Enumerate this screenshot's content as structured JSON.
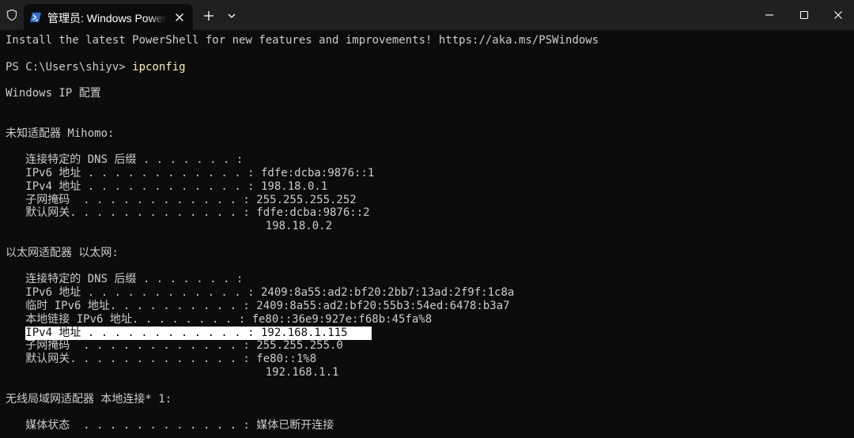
{
  "window": {
    "tab_title": "管理员: Windows PowerShell"
  },
  "terminal": {
    "lines": [
      "Install the latest PowerShell for new features and improvements! https://aka.ms/PSWindows",
      "",
      "PS C:\\Users\\shiyv> ",
      "",
      "Windows IP 配置",
      "",
      "",
      "未知适配器 Mihomo:",
      "",
      "   连接特定的 DNS 后缀 . . . . . . . :",
      "   IPv6 地址 . . . . . . . . . . . . : fdfe:dcba:9876::1",
      "   IPv4 地址 . . . . . . . . . . . . : 198.18.0.1",
      "   子网掩码  . . . . . . . . . . . . : 255.255.255.252",
      "   默认网关. . . . . . . . . . . . . : fdfe:dcba:9876::2",
      "                                       198.18.0.2",
      "",
      "以太网适配器 以太网:",
      "",
      "   连接特定的 DNS 后缀 . . . . . . . :",
      "   IPv6 地址 . . . . . . . . . . . . : 2409:8a55:ad2:bf20:2bb7:13ad:2f9f:1c8a",
      "   临时 IPv6 地址. . . . . . . . . . : 2409:8a55:ad2:bf20:55b3:54ed:6478:b3a7",
      "   本地链接 IPv6 地址. . . . . . . . : fe80::36e9:927e:f68b:45fa%8",
      "   IPv4 地址 . . . . . . . . . . . . : 192.168.1.115",
      "   子网掩码  . . . . . . . . . . . . : 255.255.255.0",
      "   默认网关. . . . . . . . . . . . . : fe80::1%8",
      "                                       192.168.1.1",
      "",
      "无线局域网适配器 本地连接* 1:",
      "",
      "   媒体状态  . . . . . . . . . . . . : 媒体已断开连接"
    ],
    "command": "ipconfig",
    "prompt_line_index": 2,
    "highlighted_line_index": 22
  },
  "colors": {
    "background": "#0c0c0c",
    "titlebar": "#202020",
    "text": "#cccccc",
    "command": "#f9f1a5",
    "selection": "#ffffff"
  },
  "icons": {
    "shield": "shield-icon",
    "powershell": "powershell-icon",
    "close_tab": "close-icon",
    "new_tab": "plus-icon",
    "dropdown": "chevron-down-icon",
    "minimize": "minimize-icon",
    "maximize": "maximize-icon",
    "close_window": "close-icon"
  }
}
